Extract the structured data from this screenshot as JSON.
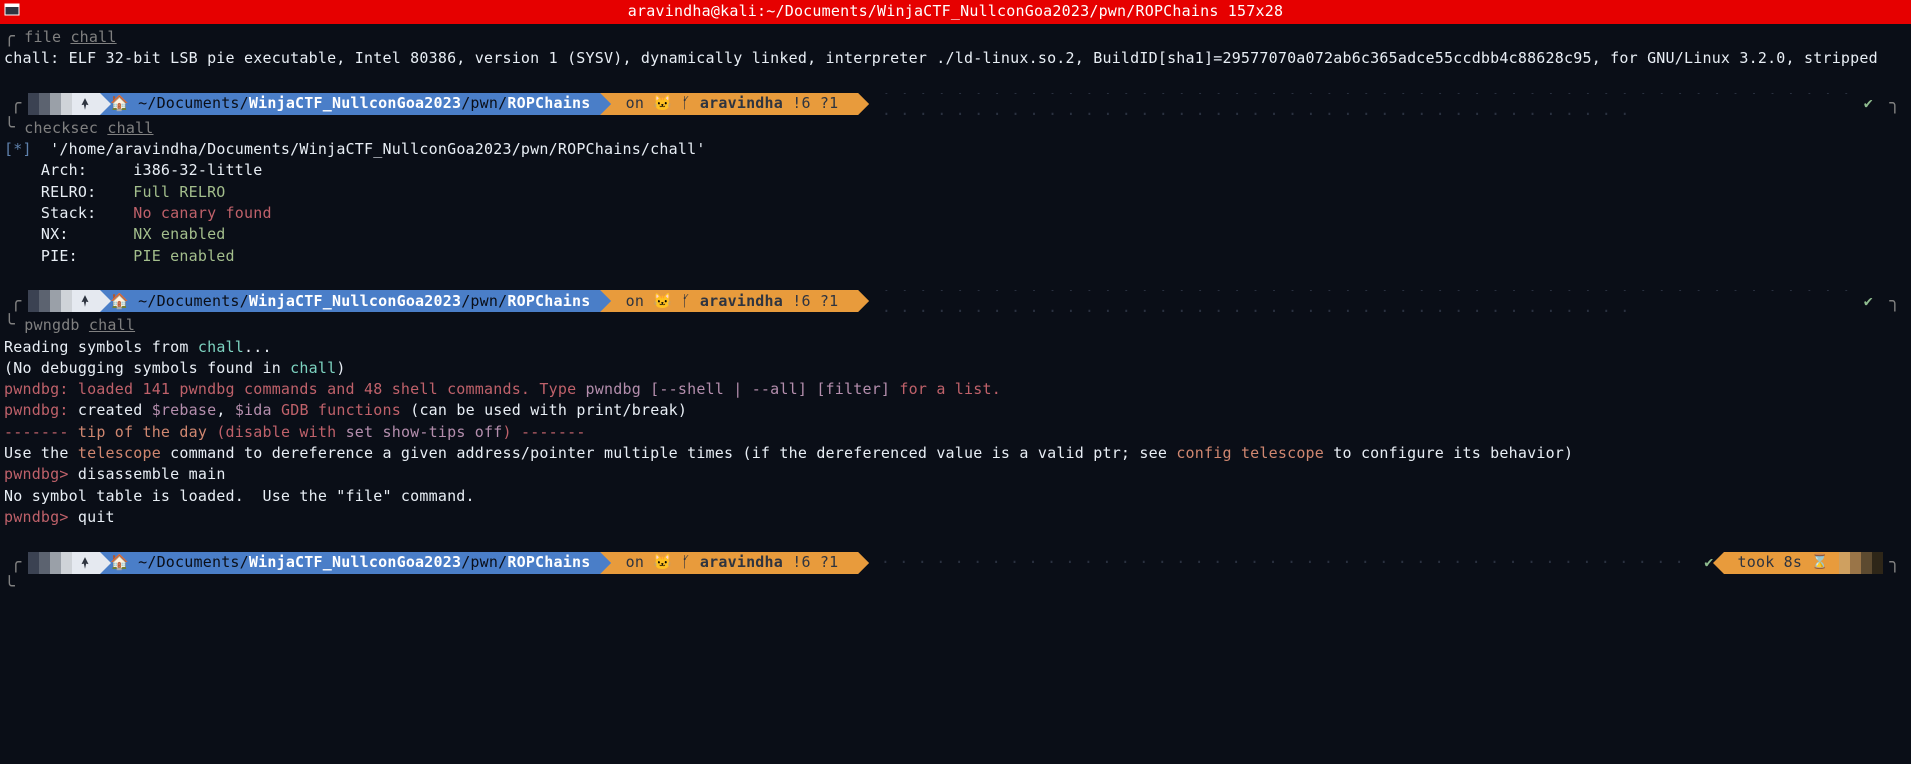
{
  "titlebar": "aravindha@kali:~/Documents/WinjaCTF_NullconGoa2023/pwn/ROPChains 157x28",
  "path": {
    "home": "~",
    "p1": "/Documents/",
    "bold": "WinjaCTF_NullconGoa2023",
    "p2": "/pwn/",
    "leaf": "ROPChains"
  },
  "git": {
    "on": " on ",
    "branch_icon": "🐱 ᚶ ",
    "branch": "aravindha",
    "status": " !6 ?1 "
  },
  "took": "took 8s ",
  "checkmark": "✔",
  "dots": " · · · · · · · · · · · · · · · · · · · · · · · · · · · · · · · · · · · · · · · · · · · · · · · · · · · · · · · · · · · · · · · · · · · · · · · · · · · · · · · · · · · · · · · · · · · · · ·",
  "blk1": {
    "cmd_pre": " file ",
    "cmd_arg": "chall",
    "out": "chall: ELF 32-bit LSB pie executable, Intel 80386, version 1 (SYSV), dynamically linked, interpreter ./ld-linux.so.2, BuildID[sha1]=29577070a072ab6c365adce55ccdbb4c88628c95, for GNU/Linux 3.2.0, stripped"
  },
  "blk2": {
    "cmd_pre": " checksec ",
    "cmd_arg": "chall",
    "star": "[*]",
    "path": "  '/home/aravindha/Documents/WinjaCTF_NullconGoa2023/pwn/ROPChains/chall'",
    "rows": [
      {
        "k": "    Arch:     ",
        "v": "i386-32-little",
        "cls": "white"
      },
      {
        "k": "    RELRO:    ",
        "v": "Full RELRO",
        "cls": "green"
      },
      {
        "k": "    Stack:    ",
        "v": "No canary found",
        "cls": "red"
      },
      {
        "k": "    NX:       ",
        "v": "NX enabled",
        "cls": "green"
      },
      {
        "k": "    PIE:      ",
        "v": "PIE enabled",
        "cls": "green"
      }
    ]
  },
  "blk3": {
    "cmd_pre": " pwngdb ",
    "cmd_arg": "chall",
    "l1a": "Reading symbols from ",
    "l1b": "chall",
    "l1c": "...",
    "l2a": "(No debugging symbols found in ",
    "l2b": "chall",
    "l2c": ")",
    "l3a": "pwndbg: loaded 141 pwndbg commands and 48 shell commands. Type ",
    "l3b": "pwndbg [--shell | --all] [filter] ",
    "l3c": "for a list.",
    "l4a": "pwndbg: ",
    "l4b": "created ",
    "l4c": "$rebase",
    "l4d": ", ",
    "l4e": "$ida",
    "l4f": " GDB functions ",
    "l4g": "(can be used with print/break)",
    "l5a": "------- ",
    "l5b": "tip of the day",
    "l5c": " (disable with ",
    "l5d": "set show-tips off",
    "l5e": ") -------",
    "l6a": "Use the ",
    "l6b": "telescope",
    "l6c": " command to dereference a given address/pointer multiple times (if the dereferenced value is a valid ptr; see ",
    "l6d": "config telescope",
    "l6e": " to configure its behavior)",
    "p1": "pwndbg> ",
    "c1": "disassemble main",
    "l8": "No symbol table is loaded.  Use the \"file\" command.",
    "p2": "pwndbg> ",
    "c2": "quit"
  }
}
